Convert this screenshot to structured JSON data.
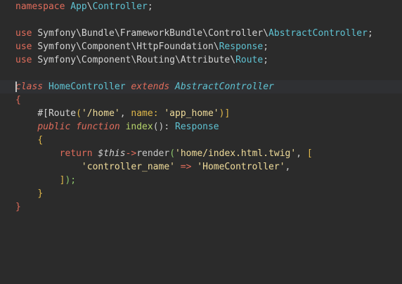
{
  "editor": {
    "language": "php",
    "lines": {
      "ns_kw": "namespace",
      "ns_app": "App",
      "ns_sep": "\\",
      "ns_ctrl": "Controller",
      "ns_semi": ";",
      "use1_kw": "use",
      "use1_path": "Symfony\\Bundle\\FrameworkBundle\\Controller\\",
      "use1_cls": "AbstractController",
      "use1_semi": ";",
      "use2_kw": "use",
      "use2_path": "Symfony\\Component\\HttpFoundation\\",
      "use2_cls": "Response",
      "use2_semi": ";",
      "use3_kw": "use",
      "use3_path": "Symfony\\Component\\Routing\\Attribute\\",
      "use3_cls": "Route",
      "use3_semi": ";",
      "class_kw": "class",
      "class_name": "HomeController",
      "extends_kw": "extends",
      "parent_cls": "AbstractController",
      "open_brace": "{",
      "attr_open": "#[",
      "attr_name": "Route",
      "attr_paren": "(",
      "attr_path": "'/home'",
      "attr_comma": ", ",
      "attr_arg": "name:",
      "attr_val": "'app_home'",
      "attr_close": ")]",
      "public_kw": "public",
      "function_kw": "function",
      "method_name": "index",
      "method_parens": "(): ",
      "return_type": "Response",
      "method_open": "{",
      "return_kw": "return",
      "this_var": "$this",
      "arrow": "->",
      "render_fn": "render",
      "render_paren": "(",
      "template_str": "'home/index.html.twig'",
      "render_comma": ", ",
      "array_open": "[",
      "key_str": "'controller_name'",
      "fat_arrow": " => ",
      "val_str": "'HomeController'",
      "val_comma": ",",
      "array_close": "]",
      "render_close": ");",
      "method_close": "}",
      "class_close": "}"
    }
  }
}
